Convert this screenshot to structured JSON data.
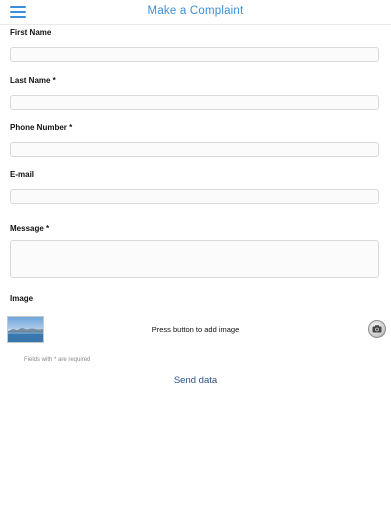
{
  "header": {
    "title": "Make a Complaint",
    "menu_icon": "hamburger-menu-icon",
    "accent_color": "#3b8fd6"
  },
  "form": {
    "first_name": {
      "label": "First Name",
      "value": "",
      "placeholder": ""
    },
    "last_name": {
      "label": "Last Name *",
      "value": "",
      "placeholder": ""
    },
    "phone": {
      "label": "Phone Number *",
      "value": "",
      "placeholder": ""
    },
    "email": {
      "label": "E-mail",
      "value": "",
      "placeholder": ""
    },
    "message": {
      "label": "Message *",
      "value": "",
      "placeholder": ""
    },
    "image": {
      "label": "Image",
      "add_text": "Press button to add image",
      "camera_icon": "camera-icon"
    },
    "required_note": "Fields with * are required",
    "send_label": "Send data",
    "send_color": "#274f86"
  }
}
